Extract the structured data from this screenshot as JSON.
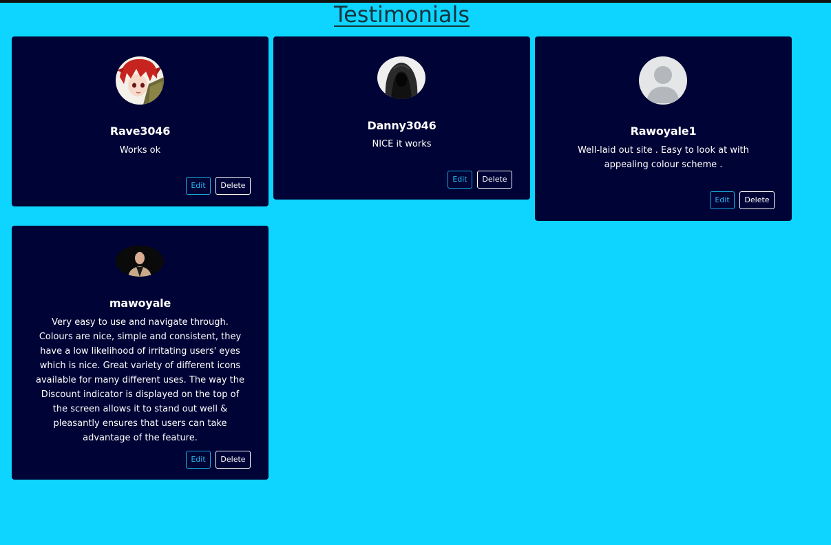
{
  "page": {
    "title": "Testimonials"
  },
  "colors": {
    "background": "#0dd5ff",
    "card": "#000335",
    "edit_accent": "#23b8ef"
  },
  "testimonials": [
    {
      "username": "Rave3046",
      "comment": "Works ok",
      "avatar": "anime-red-hair-avatar",
      "edit_label": "Edit",
      "delete_label": "Delete"
    },
    {
      "username": "Danny3046",
      "comment": "NICE it works",
      "avatar": "hooded-figure-avatar",
      "edit_label": "Edit",
      "delete_label": "Delete"
    },
    {
      "username": "Rawoyale1",
      "comment": "Well-laid out site . Easy to look at with appealing colour scheme .",
      "avatar": "default-user-avatar",
      "edit_label": "Edit",
      "delete_label": "Delete"
    },
    {
      "username": "mawoyale",
      "comment": "Very easy to use and navigate through. Colours are nice, simple and consistent, they have a low likelihood of irritating users' eyes which is nice. Great variety of different icons available for many different uses. The way the Discount indicator is displayed on the top of the screen allows it to stand out well & pleasantly ensures that users can take advantage of the feature.",
      "avatar": "man-portrait-avatar",
      "edit_label": "Edit",
      "delete_label": "Delete"
    }
  ]
}
